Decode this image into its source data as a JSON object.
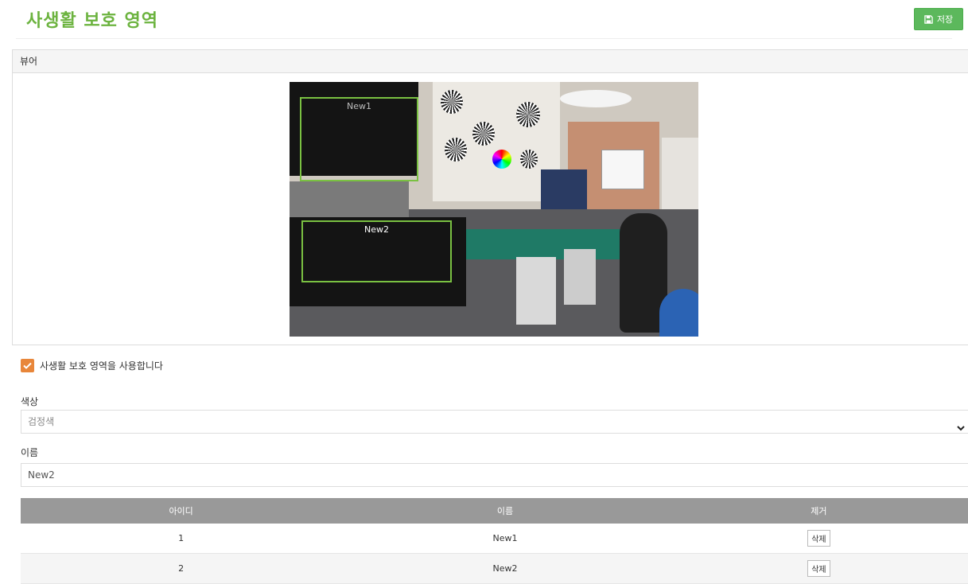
{
  "page": {
    "title": "사생활 보호 영역",
    "accent": "#6cb33f"
  },
  "toolbar": {
    "save_label": "저장",
    "save_icon": "floppy-disk-icon"
  },
  "viewer": {
    "header": "뷰어",
    "zones": [
      {
        "label": "New1"
      },
      {
        "label": "New2"
      }
    ]
  },
  "settings": {
    "enable_label": "사생활 보호 영역을 사용합니다",
    "enabled": true,
    "color_label": "색상",
    "color_value": "검정색",
    "name_label": "이름",
    "name_value": "New2"
  },
  "table": {
    "columns": [
      "아이디",
      "이름",
      "제거"
    ],
    "delete_label": "삭제",
    "rows": [
      {
        "id": "1",
        "name": "New1"
      },
      {
        "id": "2",
        "name": "New2"
      }
    ]
  }
}
